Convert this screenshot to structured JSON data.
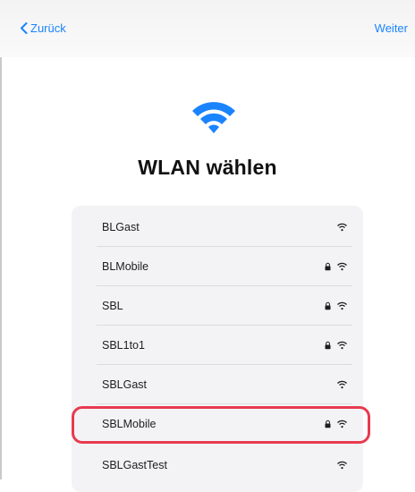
{
  "nav": {
    "back_label": "Zurück",
    "next_label": "Weiter"
  },
  "page": {
    "title": "WLAN wählen"
  },
  "networks": [
    {
      "name": "BLGast",
      "locked": false
    },
    {
      "name": "BLMobile",
      "locked": true
    },
    {
      "name": "SBL",
      "locked": true
    },
    {
      "name": "SBL1to1",
      "locked": true
    },
    {
      "name": "SBLGast",
      "locked": false
    },
    {
      "name": "SBLMobile",
      "locked": true
    },
    {
      "name": "SBLGastTest",
      "locked": false
    }
  ],
  "highlighted_network": "SBLMobile",
  "colors": {
    "accent": "#1a84ff",
    "highlight": "#e83a4f",
    "list_bg": "#f3f3f5"
  },
  "icons": {
    "hero": "wifi-icon",
    "back": "chevron-left-icon",
    "lock": "lock-icon",
    "signal": "wifi-signal-icon"
  }
}
